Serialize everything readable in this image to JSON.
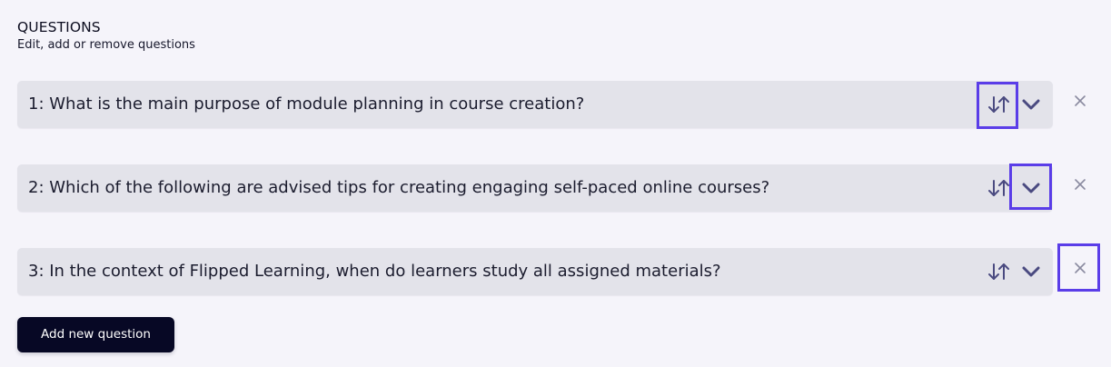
{
  "section": {
    "title": "QUESTIONS",
    "subtitle": "Edit, add or remove questions"
  },
  "questions": [
    {
      "label": "1: What is the main purpose of module planning in course creation?"
    },
    {
      "label": "2: Which of the following are advised tips for creating engaging self-paced online courses?"
    },
    {
      "label": "3: In the context of Flipped Learning, when do learners study all assigned materials?"
    }
  ],
  "icons": {
    "reorder": "sort-arrows-icon",
    "expand": "chevron-down-icon",
    "remove": "close-icon"
  },
  "colors": {
    "background": "#f5f4fa",
    "card": "#e3e3ea",
    "icon": "#4a4a80",
    "remove_icon": "#8a8aa0",
    "highlight": "#5a3de8",
    "button": "#070825"
  },
  "actions": {
    "add_label": "Add new question"
  }
}
